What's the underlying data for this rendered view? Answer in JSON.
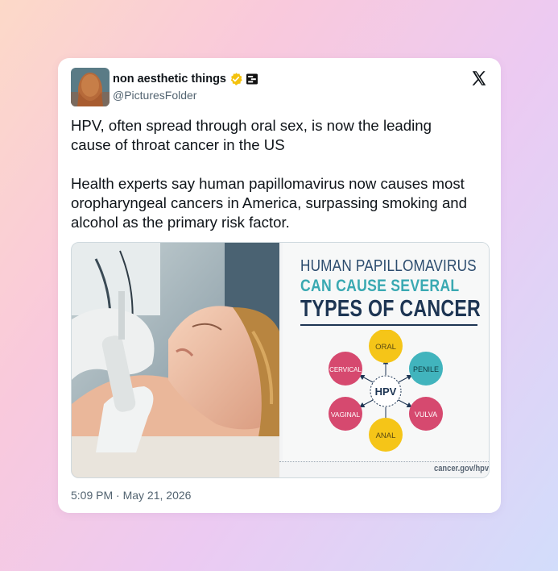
{
  "author": {
    "name": "non aesthetic things",
    "handle": "@PicturesFolder",
    "verified": true
  },
  "tweet": {
    "paragraphs": [
      "HPV, often spread through oral sex, is now the leading cause of throat cancer in the US",
      "Health experts say human papillomavirus now causes most oropharyngeal cancers in America, surpassing smoking and alcohol as the primary risk factor."
    ],
    "time": "5:09 PM",
    "separator": "·",
    "date": "May 21, 2026"
  },
  "infographic": {
    "line1": "HUMAN PAPILLOMAVIRUS",
    "line2": "CAN CAUSE SEVERAL",
    "line3": "TYPES OF CANCER",
    "center": "HPV",
    "cancers": [
      "ORAL",
      "PENILE",
      "VULVA",
      "ANAL",
      "VAGINAL",
      "CERVICAL"
    ],
    "source": "cancer.gov/hpv"
  },
  "icons": {
    "verified": "verified-badge-icon",
    "affiliate": "affiliate-badge-icon",
    "platform": "x-logo-icon"
  },
  "colors": {
    "verified": "#f4c20d",
    "oral": "#f5c518",
    "penile": "#41b4bd",
    "vulva": "#d6496f",
    "anal": "#f5c518",
    "vaginal": "#d6496f",
    "cervical": "#d6496f",
    "navy": "#1d3553",
    "teal": "#3aa9b2"
  }
}
